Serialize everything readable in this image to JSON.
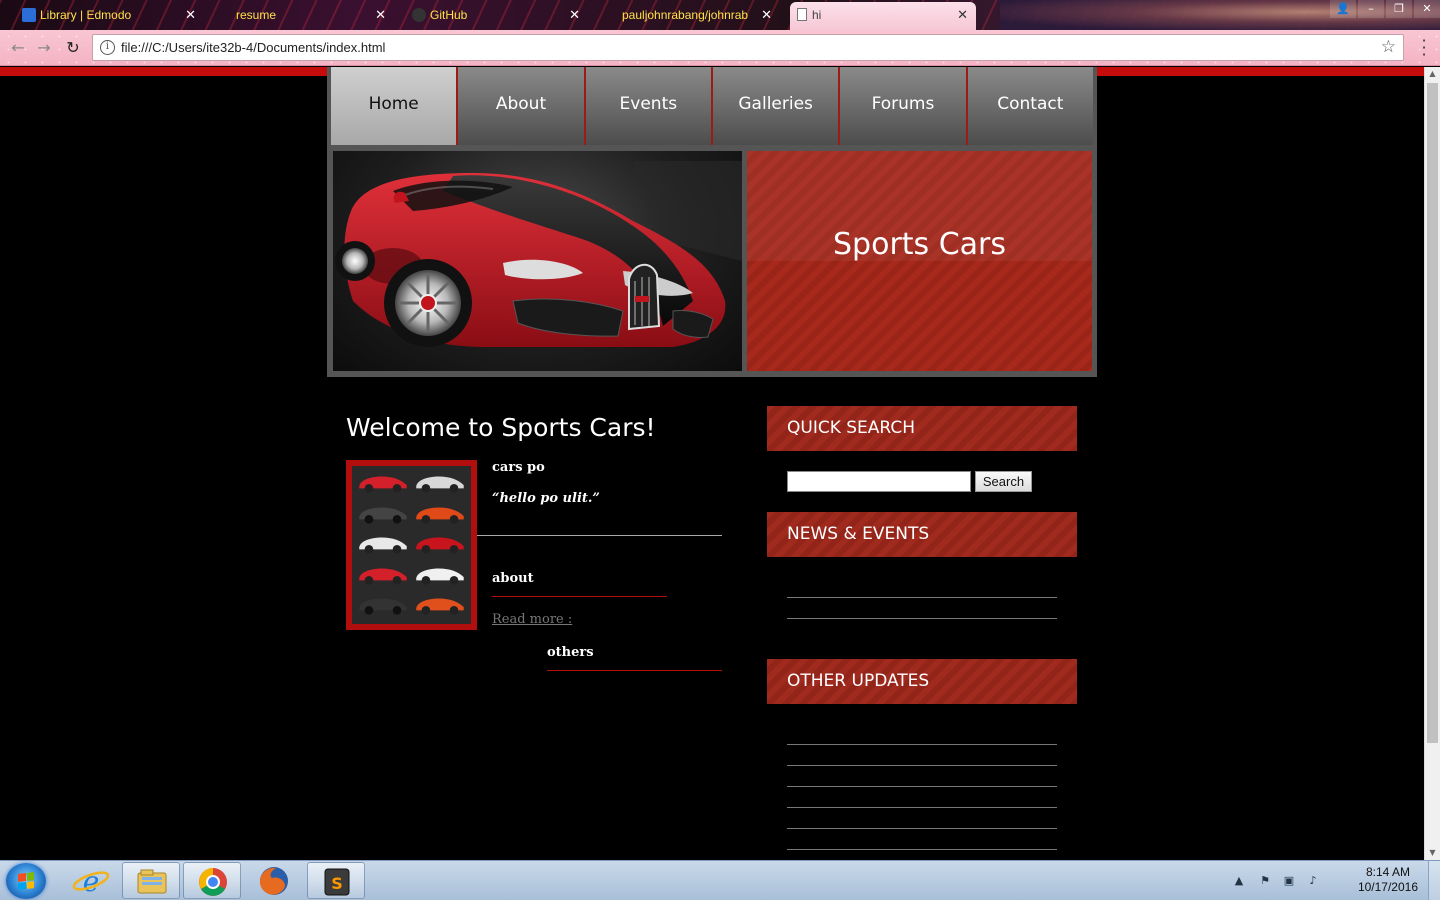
{
  "browser": {
    "tabs": [
      {
        "title": "Library | Edmodo",
        "favicon_color": "#2b6fd6"
      },
      {
        "title": "resume",
        "favicon_color": ""
      },
      {
        "title": "GitHub",
        "favicon_color": "#333333"
      },
      {
        "title": "pauljohnrabang/johnrab",
        "favicon_color": ""
      },
      {
        "title": "hi",
        "favicon_color": "#ffffff",
        "active": true
      }
    ],
    "address": {
      "url": "file:///C:/Users/ite32b-4/Documents/index.html"
    }
  },
  "site": {
    "nav": [
      "Home",
      "About",
      "Events",
      "Galleries",
      "Forums",
      "Contact"
    ],
    "active_nav": "Home",
    "banner_title": "Sports Cars",
    "welcome_heading": "Welcome to Sports Cars!",
    "post": {
      "title": "cars po",
      "quote": "“hello po ulit.”",
      "section_about": "about",
      "read_more": "Read more :",
      "section_others": "others"
    },
    "sidebar": {
      "quick_search": "QUICK SEARCH",
      "search_button": "Search",
      "search_value": "",
      "news_events": "NEWS & EVENTS",
      "other_updates": "OTHER UPDATES"
    },
    "colors": {
      "accent_red": "#c40c0c",
      "panel_red": "#a02a1d",
      "nav_gray": "#6a6a6a"
    }
  },
  "taskbar": {
    "time": "8:14 AM",
    "date": "10/17/2016",
    "pinned": [
      "internet-explorer-icon",
      "file-explorer-icon",
      "chrome-icon",
      "firefox-icon",
      "sublime-text-icon"
    ]
  }
}
